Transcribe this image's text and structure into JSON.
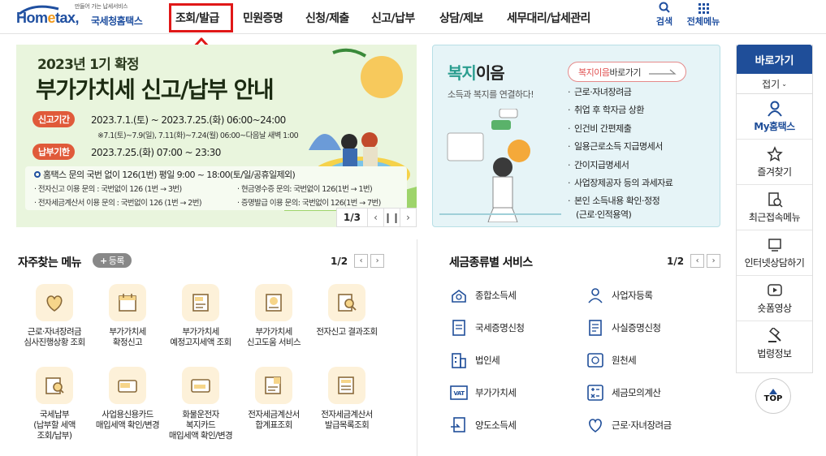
{
  "header": {
    "logo_small": "만들어 가는 납세서비스",
    "logo_brand_a": "Hom",
    "logo_brand_e": "e",
    "logo_brand_b": "tax,",
    "logo_ko": "국세청홈택스",
    "nav": [
      "조회/발급",
      "민원증명",
      "신청/제출",
      "신고/납부",
      "상담/제보",
      "세무대리/납세관리"
    ],
    "search_label": "검색",
    "allmenu_label": "전체메뉴"
  },
  "banner": {
    "subtitle": "2023년 1기 확정",
    "title": "부가가치세 신고/납부 안내",
    "period_label": "신고기간",
    "period_text": "2023.7.1.(토) ~ 2023.7.25.(화) 06:00~24:00",
    "period_note": "※7.1(토)~7.9(일), 7.11(화)~7.24(월) 06:00~다음날 새벽 1:00",
    "deadline_label": "납부기한",
    "deadline_text": "2023.7.25.(화) 07:00 ~ 23:30",
    "info_main": "홈택스 문의 국번 없이 126(1번) 평일 9:00 ~ 18:00(토/일/공휴일제외)",
    "info_1": "· 전자신고 이용 문의 : 국번없이 126 (1번 → 3번)",
    "info_2": "· 현금영수증 문의: 국번없이 126(1번 → 1번)",
    "info_3": "· 전자세금계산서 이용 문의 : 국번없이 126 (1번 → 2번)",
    "info_4": "· 증명발급 이용 문의: 국번없이 126(1번 → 7번)",
    "pager": "1/3",
    "icon_prev": "chevron-left-icon",
    "icon_pause": "pause-icon",
    "icon_next": "chevron-right-icon"
  },
  "bokji": {
    "title_a": "복지",
    "title_b": "이음",
    "subtitle": "소득과 복지를 연결하다!",
    "go_hi": "복지이음",
    "go_rest": " 바로가기",
    "items": [
      "근로·자녀장려금",
      "취업 후 학자금 상환",
      "인건비 간편제출",
      "일용근로소득 지급명세서",
      "간이지급명세서",
      "사업장제공자 등의 과세자료",
      "본인 소득내용 확인·정정",
      "(근로·인적용역)"
    ]
  },
  "sidebar": {
    "head": "바로가기",
    "fold": "접기",
    "items": [
      "My홈택스",
      "즐겨찾기",
      "최근접속메뉴",
      "인터넷상담하기",
      "숏폼영상",
      "법령정보"
    ],
    "top": "TOP"
  },
  "fav": {
    "title": "자주찾는 메뉴",
    "register": "등록",
    "pager": "1/2",
    "items": [
      "근로·자녀장려금\n심사진행상황 조회",
      "부가가치세\n확정신고",
      "부가가치세\n예정고지세액 조회",
      "부가가치세\n신고도움 서비스",
      "전자신고 결과조회",
      "국세납부\n(납부할 세액\n조회/납부)",
      "사업용신용카드\n매입세액 확인/변경",
      "화물운전자\n복지카드\n매입세액 확인/변경",
      "전자세금계산서\n합계표조회",
      "전자세금계산서\n발급목록조회"
    ]
  },
  "tax": {
    "title": "세금종류별 서비스",
    "pager": "1/2",
    "left": [
      "종합소득세",
      "국세증명신청",
      "법인세",
      "부가가치세",
      "양도소득세"
    ],
    "right": [
      "사업자등록",
      "사실증명신청",
      "원천세",
      "세금모의계산",
      "근로·자녀장려금"
    ]
  }
}
